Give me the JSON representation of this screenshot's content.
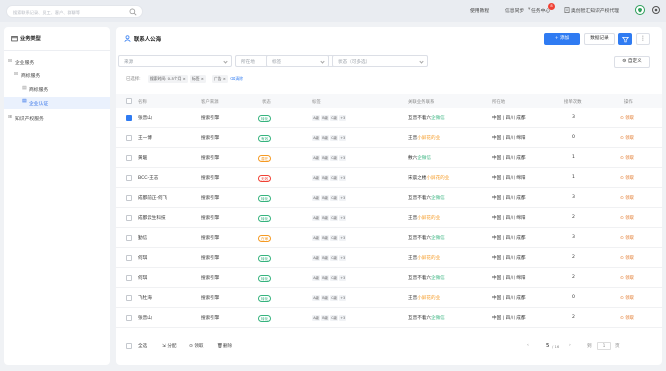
{
  "topbar": {
    "search_placeholder": "搜索联系记录、员工、客户、群聊等",
    "items": [
      "使用教程",
      "信息同步",
      "任务中心",
      "奥创智汇知识产权代理"
    ],
    "task_badge": "8"
  },
  "sidebar": {
    "title": "业务类型",
    "items": [
      {
        "label": "企业服务",
        "level": 0,
        "expander": "minus",
        "selected": false
      },
      {
        "label": "商标服务",
        "level": 1,
        "expander": "minus",
        "selected": false
      },
      {
        "label": "商标服务",
        "level": 2,
        "expander": "",
        "selected": false
      },
      {
        "label": "企业认证",
        "level": 2,
        "expander": "",
        "selected": true
      },
      {
        "label": "知识产权服务",
        "level": 0,
        "expander": "plus",
        "selected": false
      }
    ]
  },
  "main": {
    "title": "联系人公海",
    "add_button": "+ 添加",
    "records_button": "数据记录",
    "filters": [
      "来源",
      "所在地",
      "标签",
      "状态（可多选）"
    ],
    "custom_button": "自定义",
    "selected_label": "已选择:",
    "chips": [
      "搜索时间: 0-5个月 ×",
      "标签 ×",
      "广告 ×"
    ],
    "clear_label": "清除"
  },
  "table": {
    "columns": [
      "名称",
      "客户来源",
      "状态",
      "标签",
      "关联业务联系",
      "所在地",
      "接单次数",
      "操作"
    ],
    "rows": [
      {
        "name": "张晋山",
        "source": "搜索引擎",
        "status": "转化",
        "status_color": "#36b37e",
        "tags": [
          "A级",
          "B级",
          "C级",
          "+3"
        ],
        "rel_name": "互晋不着六",
        "rel_sub": "企微信",
        "rel_color": "#36b37e",
        "location": "中国 | 四川 成都",
        "count": "3",
        "op": "领取",
        "checked": true
      },
      {
        "name": "王一博",
        "source": "搜索引擎",
        "status": "有效",
        "status_color": "#36b37e",
        "tags": [
          "A级",
          "B级",
          "C级",
          "+3"
        ],
        "rel_name": "王晋",
        "rel_sub": "小屏花的业",
        "rel_color": "#f59a23",
        "location": "中国 | 四川 绵阳",
        "count": "0",
        "op": "领取",
        "checked": false
      },
      {
        "name": "黄暖",
        "source": "搜索引擎",
        "status": "潜在",
        "status_color": "#f59a23",
        "tags": [
          "A级",
          "B级",
          "C级",
          "+3"
        ],
        "rel_name": "敷六",
        "rel_sub": "企微信",
        "rel_color": "#36b37e",
        "location": "中国 | 四川 成都",
        "count": "1",
        "op": "领取",
        "checked": false
      },
      {
        "name": "BCC-王志",
        "source": "搜索引擎",
        "status": "无效",
        "status_color": "#f04134",
        "tags": [
          "A级",
          "B级",
          "C级",
          "+3"
        ],
        "rel_name": "宋晨之楼",
        "rel_sub": "小屏花的业",
        "rel_color": "#f59a23",
        "location": "中国 | 四川 绵阳",
        "count": "1",
        "op": "领取",
        "checked": false
      },
      {
        "name": "成都前正-何飞",
        "source": "搜索引擎",
        "status": "转化",
        "status_color": "#36b37e",
        "tags": [
          "A级",
          "B级",
          "C级",
          "+3"
        ],
        "rel_name": "互晋不着六",
        "rel_sub": "企微信",
        "rel_color": "#36b37e",
        "location": "中国 | 四川 成都",
        "count": "3",
        "op": "领取",
        "checked": false
      },
      {
        "name": "成都云生科技",
        "source": "搜索引擎",
        "status": "转化",
        "status_color": "#36b37e",
        "tags": [
          "A级",
          "B级",
          "C级",
          "+3"
        ],
        "rel_name": "王晋",
        "rel_sub": "小屏花的业",
        "rel_color": "#f59a23",
        "location": "中国 | 四川 绵阳",
        "count": "2",
        "op": "领取",
        "checked": false
      },
      {
        "name": "勤信",
        "source": "搜索引擎",
        "status": "在审",
        "status_color": "#f59a23",
        "tags": [
          "A级",
          "B级",
          "C级",
          "+3"
        ],
        "rel_name": "互晋不着六",
        "rel_sub": "企微信",
        "rel_color": "#36b37e",
        "location": "中国 | 四川 成都",
        "count": "3",
        "op": "领取",
        "checked": false
      },
      {
        "name": "何琪",
        "source": "搜索引擎",
        "status": "转化",
        "status_color": "#36b37e",
        "tags": [
          "A级",
          "B级",
          "C级",
          "+3"
        ],
        "rel_name": "王晋",
        "rel_sub": "小屏花的业",
        "rel_color": "#f59a23",
        "location": "中国 | 四川 成都",
        "count": "2",
        "op": "领取",
        "checked": false
      },
      {
        "name": "何琪",
        "source": "搜索引擎",
        "status": "转化",
        "status_color": "#36b37e",
        "tags": [
          "A级",
          "B级",
          "C级",
          "+3"
        ],
        "rel_name": "互晋不着六",
        "rel_sub": "企微信",
        "rel_color": "#36b37e",
        "location": "中国 | 四川 绵阳",
        "count": "2",
        "op": "领取",
        "checked": false
      },
      {
        "name": "飞牡海",
        "source": "搜索引擎",
        "status": "转化",
        "status_color": "#36b37e",
        "tags": [
          "A级",
          "B级",
          "C级",
          "+3"
        ],
        "rel_name": "王晋",
        "rel_sub": "小屏花的业",
        "rel_color": "#f59a23",
        "location": "中国 | 四川 成都",
        "count": "0",
        "op": "领取",
        "checked": false
      },
      {
        "name": "张晋山",
        "source": "搜索引擎",
        "status": "转化",
        "status_color": "#36b37e",
        "tags": [
          "A级",
          "B级",
          "C级",
          "+3"
        ],
        "rel_name": "互晋不着六",
        "rel_sub": "企微信",
        "rel_color": "#36b37e",
        "location": "中国 | 四川 成都",
        "count": "2",
        "op": "领取",
        "checked": false
      }
    ]
  },
  "footer": {
    "select_all": "全选",
    "actions": [
      "分配",
      "领取",
      "删除"
    ],
    "page_current": "5",
    "page_total": "/ 16",
    "page_jump": "到",
    "page_input": "1",
    "page_unit": "页"
  },
  "colors": {
    "primary": "#2f7bf2",
    "success": "#36b37e",
    "warning": "#f59a23",
    "danger": "#f04134",
    "op": "#e37b2f"
  }
}
